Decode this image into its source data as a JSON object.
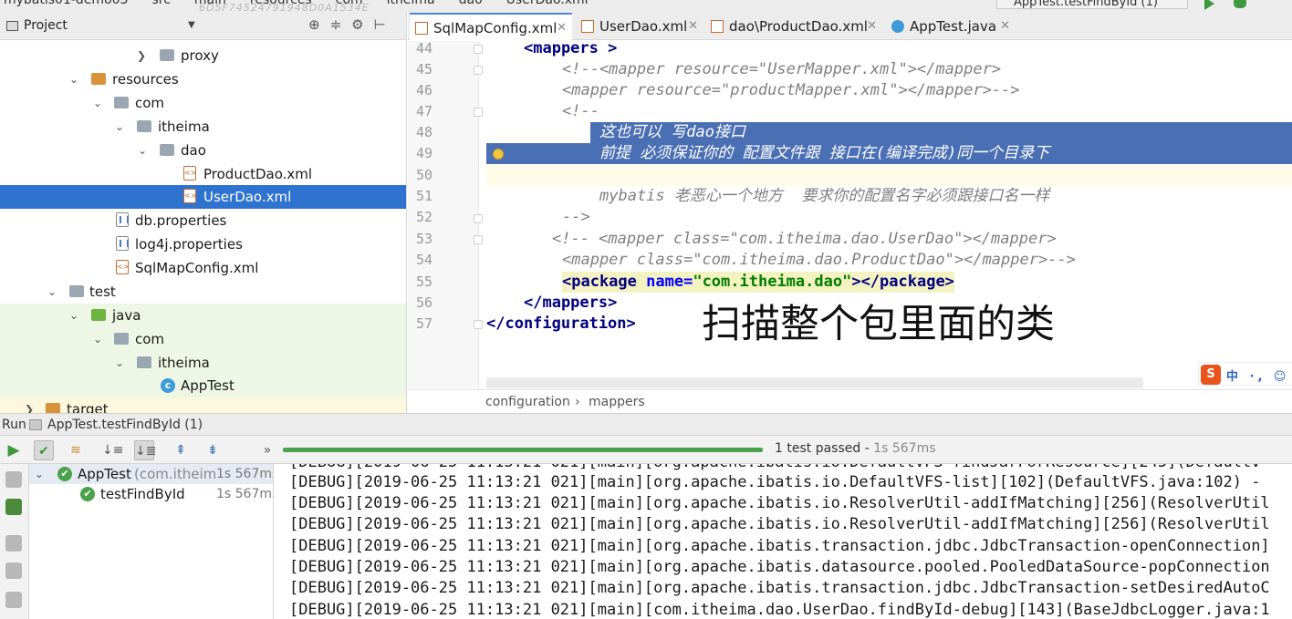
{
  "top": {
    "breadcrumbs": [
      "mybatis01-demo03",
      "src",
      "main",
      "resources",
      "com",
      "itheima",
      "dao",
      "UserDao.xml"
    ],
    "watermark": "6D5F74524791948D0A1534E",
    "run_config": "AppTest.testFindById (1)"
  },
  "project": {
    "title": "Project",
    "tree": [
      {
        "label": "proxy",
        "type": "folder"
      },
      {
        "label": "resources",
        "type": "folder"
      },
      {
        "label": "com",
        "type": "folder"
      },
      {
        "label": "itheima",
        "type": "folder"
      },
      {
        "label": "dao",
        "type": "folder"
      },
      {
        "label": "ProductDao.xml",
        "type": "xml"
      },
      {
        "label": "UserDao.xml",
        "type": "xml"
      },
      {
        "label": "db.properties",
        "type": "properties"
      },
      {
        "label": "log4j.properties",
        "type": "properties"
      },
      {
        "label": "SqlMapConfig.xml",
        "type": "xml"
      },
      {
        "label": "test",
        "type": "folder"
      },
      {
        "label": "java",
        "type": "folder"
      },
      {
        "label": "com",
        "type": "folder"
      },
      {
        "label": "itheima",
        "type": "folder"
      },
      {
        "label": "AppTest",
        "type": "class"
      },
      {
        "label": "target",
        "type": "folder"
      }
    ]
  },
  "tabs": [
    {
      "label": "SqlMapConfig.xml",
      "active": true
    },
    {
      "label": "UserDao.xml",
      "active": false
    },
    {
      "label": "dao\\ProductDao.xml",
      "active": false
    },
    {
      "label": "AppTest.java",
      "active": false
    }
  ],
  "editor": {
    "line_numbers": [
      "44",
      "45",
      "46",
      "47",
      "48",
      "49",
      "50",
      "51",
      "52",
      "53",
      "54",
      "55",
      "56",
      "57"
    ],
    "lines": {
      "l44": {
        "a": "<mappers",
        "b": " >"
      },
      "l45": "<!--<mapper resource=\"UserMapper.xml\"></mapper>",
      "l46": "<mapper resource=\"productMapper.xml\"></mapper>-->",
      "l47": "<!--",
      "l48": "这也可以 写dao接口",
      "l49": "前提 必须保证你的 配置文件跟 接口在(编译完成)同一个目录下",
      "l51": "mybatis 老恶心一个地方  要求你的配置名字必须跟接口名一样",
      "l52": "-->",
      "l53": "<!-- <mapper class=\"com.itheima.dao.UserDao\"></mapper>",
      "l54": "<mapper class=\"com.itheima.dao.ProductDao\"></mapper>-->",
      "l55": {
        "open": "<package",
        "attr": "name=",
        "val": "\"com.itheima.dao\"",
        "close": "></package>"
      },
      "l56": "</mappers>",
      "l57": "</configuration>"
    },
    "overlay_text": "扫描整个包里面的类",
    "ime": {
      "logo": "S",
      "text": "中 ·, ☺"
    }
  },
  "breadcrumb": [
    "configuration",
    "mappers"
  ],
  "run": {
    "header_label": "Run",
    "header_config": "AppTest.testFindById (1)",
    "status": "1 test passed",
    "status_time": "1s 567ms",
    "toolbar_more": "»",
    "tests": [
      {
        "name": "AppTest",
        "detail": "(com.itheima",
        "time": "1s 567ms"
      },
      {
        "name": "testFindById",
        "detail": "",
        "time": "1s 567ms"
      }
    ],
    "console": [
      "[DEBUG][2019-06-25 11:13:21 021][main][org.apache.ibatis.io.DefaultVFS-findJarForResource][245](DefaultV",
      "[DEBUG][2019-06-25 11:13:21 021][main][org.apache.ibatis.io.DefaultVFS-list][102](DefaultVFS.java:102) -",
      "[DEBUG][2019-06-25 11:13:21 021][main][org.apache.ibatis.io.ResolverUtil-addIfMatching][256](ResolverUtil",
      "[DEBUG][2019-06-25 11:13:21 021][main][org.apache.ibatis.io.ResolverUtil-addIfMatching][256](ResolverUtil",
      "[DEBUG][2019-06-25 11:13:21 021][main][org.apache.ibatis.transaction.jdbc.JdbcTransaction-openConnection]",
      "[DEBUG][2019-06-25 11:13:21 021][main][org.apache.ibatis.datasource.pooled.PooledDataSource-popConnection",
      "[DEBUG][2019-06-25 11:13:21 021][main][org.apache.ibatis.transaction.jdbc.JdbcTransaction-setDesiredAutoC",
      "[DEBUG][2019-06-25 11:13:21 021][main][com.itheima.dao.UserDao.findById-debug][143](BaseJdbcLogger.java:1"
    ]
  },
  "colors": {
    "selection": "#2f73d1",
    "highlight": "#4a6fb5",
    "pass": "#4aa24a",
    "tag": "#000080",
    "attr_value": "#008000"
  }
}
